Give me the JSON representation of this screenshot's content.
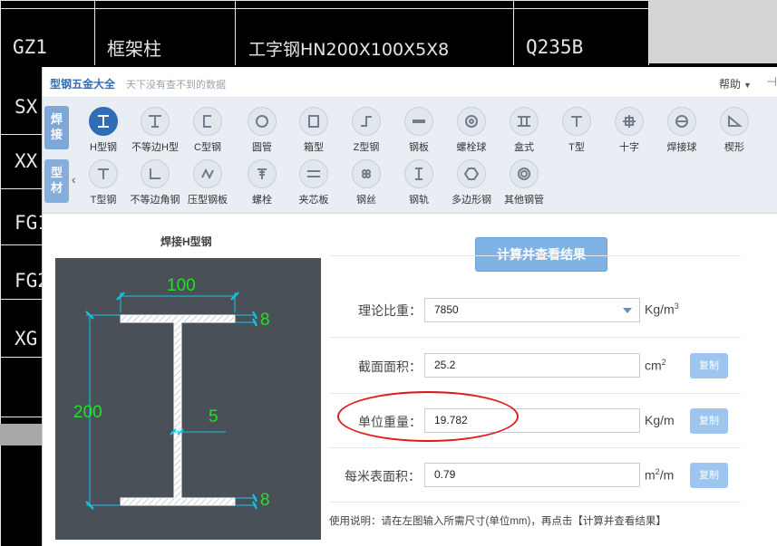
{
  "cad": {
    "header_row": [
      "GZ1",
      "框架柱",
      "工字钢HN200X100X5X8",
      "Q235B"
    ],
    "left_codes": [
      "SX",
      "XX",
      "FG1",
      "FG2",
      "XG"
    ]
  },
  "app": {
    "title": "型钢五金大全",
    "subtitle": "天下没有查不到的数据",
    "help_label": "帮助",
    "pin_label": "⊣"
  },
  "toolbar": {
    "tab_weld": "焊接",
    "tab_profile": "型材",
    "row1": [
      {
        "label": "H型钢",
        "icon": "h-beam-icon",
        "selected": true
      },
      {
        "label": "不等边H型",
        "icon": "unequal-h-icon"
      },
      {
        "label": "C型钢",
        "icon": "c-channel-icon"
      },
      {
        "label": "圆管",
        "icon": "round-tube-icon"
      },
      {
        "label": "箱型",
        "icon": "box-section-icon"
      },
      {
        "label": "Z型钢",
        "icon": "z-section-icon"
      },
      {
        "label": "钢板",
        "icon": "steel-plate-icon"
      },
      {
        "label": "螺栓球",
        "icon": "bolt-ball-icon"
      },
      {
        "label": "盒式",
        "icon": "box-type-icon"
      },
      {
        "label": "T型",
        "icon": "t-section-icon"
      },
      {
        "label": "十字",
        "icon": "cross-section-icon"
      },
      {
        "label": "焊接球",
        "icon": "weld-ball-icon"
      },
      {
        "label": "楔形",
        "icon": "wedge-icon"
      }
    ],
    "row2": [
      {
        "label": "T型钢",
        "icon": "t-steel-icon"
      },
      {
        "label": "不等边角钢",
        "icon": "unequal-angle-icon"
      },
      {
        "label": "压型钢板",
        "icon": "profiled-sheet-icon"
      },
      {
        "label": "螺栓",
        "icon": "bolt-icon"
      },
      {
        "label": "夹芯板",
        "icon": "sandwich-panel-icon"
      },
      {
        "label": "钢丝",
        "icon": "steel-wire-icon"
      },
      {
        "label": "钢轨",
        "icon": "rail-icon"
      },
      {
        "label": "多边形钢",
        "icon": "polygon-steel-icon"
      },
      {
        "label": "其他钢管",
        "icon": "other-pipe-icon"
      }
    ]
  },
  "left_panel": {
    "title": "焊接H型钢",
    "dim_width": "100",
    "dim_height": "200",
    "dim_flange_top": "8",
    "dim_flange_bottom": "8",
    "dim_web": "5"
  },
  "right_panel": {
    "calc_button": "计算并查看结果",
    "rows": [
      {
        "label": "理论比重：",
        "value": "7850",
        "unit_base": "Kg/m",
        "unit_sup": "3",
        "type": "select"
      },
      {
        "label": "截面面积：",
        "value": "25.2",
        "unit_base": "cm",
        "unit_sup": "2",
        "copy": "复制"
      },
      {
        "label": "单位重量：",
        "value": "19.782",
        "unit_base": "Kg/m",
        "unit_sup": "",
        "copy": "复制"
      },
      {
        "label": "每米表面积：",
        "value": "0.79",
        "unit_base": "m",
        "unit_sup": "2",
        "unit_tail": "/m",
        "copy": "复制"
      }
    ],
    "note": "使用说明：请在左图输入所需尺寸(单位mm)，再点击【计算并查看结果】"
  },
  "colors": {
    "accent": "#2f6db5",
    "annotation": "#e0191a",
    "dimension_green": "#22e022",
    "dimension_cyan": "#18c6e8"
  }
}
